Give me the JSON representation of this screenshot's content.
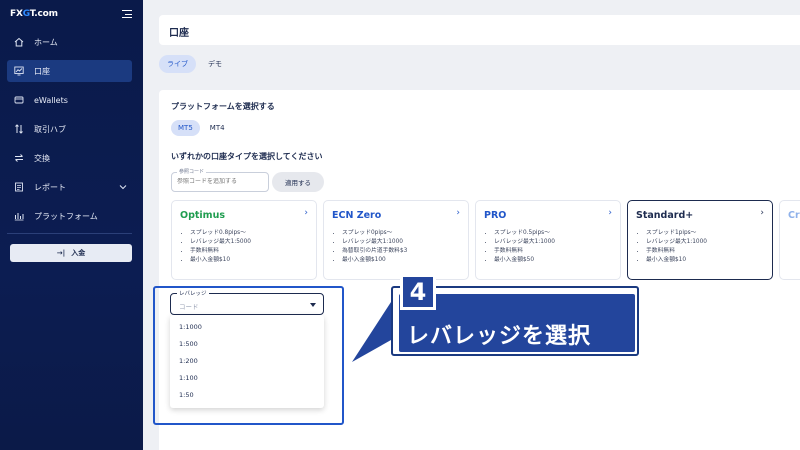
{
  "sidebar": {
    "logo_prefix": "FX",
    "logo_g": "G",
    "logo_suffix": "T.com",
    "items": [
      {
        "label": "ホーム",
        "icon": "home-icon"
      },
      {
        "label": "口座",
        "icon": "chart-icon"
      },
      {
        "label": "eWallets",
        "icon": "wallet-icon"
      },
      {
        "label": "取引ハブ",
        "icon": "updown-arrows-icon"
      },
      {
        "label": "交換",
        "icon": "swap-icon"
      },
      {
        "label": "レポート",
        "icon": "report-icon"
      },
      {
        "label": "プラットフォーム",
        "icon": "platform-icon"
      }
    ],
    "deposit_label": "入金"
  },
  "header": {
    "title": "口座"
  },
  "account_tabs": [
    "ライブ",
    "デモ"
  ],
  "platform": {
    "title": "プラットフォームを選択する",
    "options": [
      "MT5",
      "MT4"
    ],
    "selected": "MT5"
  },
  "account_type": {
    "title": "いずれかの口座タイプを選択してください",
    "ref_label": "参照コード",
    "ref_placeholder": "参照コードを追加する",
    "apply_label": "適用する"
  },
  "cards": [
    {
      "name": "Optimus",
      "color": "#1f9d4f",
      "features": [
        "スプレッド0.8pips〜",
        "レバレッジ最大1:5000",
        "手数料無料",
        "最小入金額$10"
      ]
    },
    {
      "name": "ECN Zero",
      "color": "#2156c9",
      "features": [
        "スプレッド0pips〜",
        "レバレッジ最大1:1000",
        "為替取引の片道手数料$3",
        "最小入金額$100"
      ]
    },
    {
      "name": "PRO",
      "color": "#2156c9",
      "features": [
        "スプレッド0.5pips〜",
        "レバレッジ最大1:1000",
        "手数料無料",
        "最小入金額$50"
      ]
    },
    {
      "name": "Standard+",
      "color": "#1d2b4f",
      "features": [
        "スプレッド1pips〜",
        "レバレッジ最大1:1000",
        "手数料無料",
        "最小入金額$10"
      ]
    },
    {
      "name": "Cr",
      "color": "#8fb1ea",
      "features": [
        "",
        "",
        "",
        ""
      ]
    }
  ],
  "leverage": {
    "label": "レバレッジ",
    "placeholder": "コード",
    "options": [
      "1:1000",
      "1:500",
      "1:200",
      "1:100",
      "1:50"
    ]
  },
  "callout": {
    "step": "4",
    "text": "レバレッジを選択"
  }
}
